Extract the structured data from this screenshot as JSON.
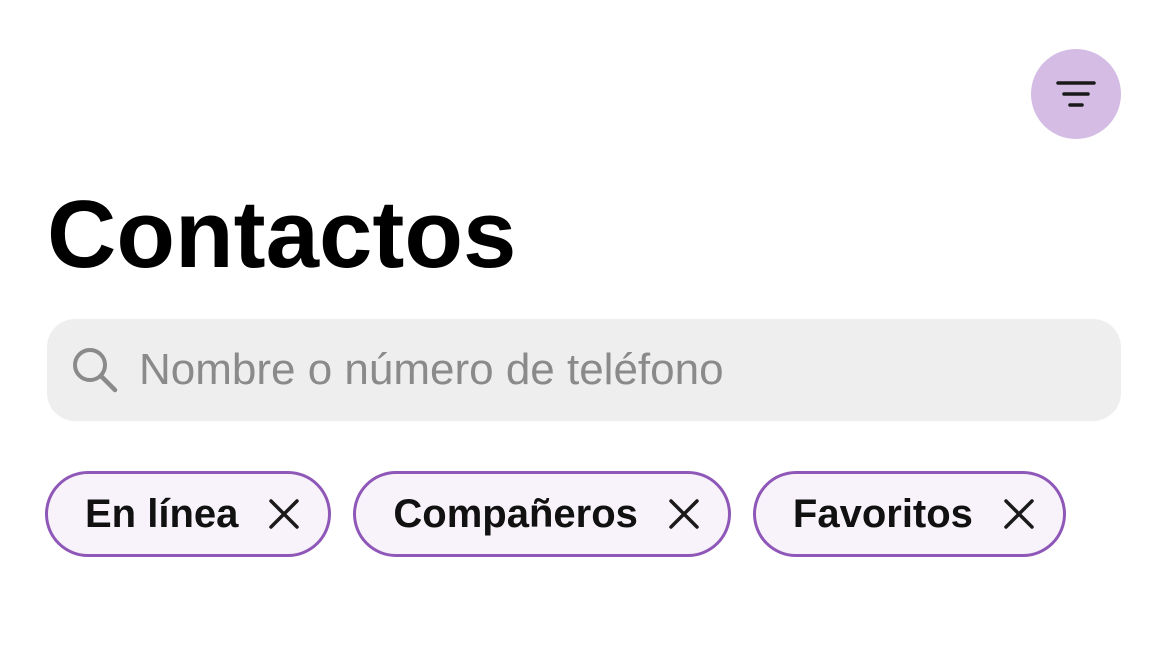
{
  "header": {
    "title": "Contactos",
    "filter_icon": "filter-lines-icon",
    "filter_button_color": "#d4bce4"
  },
  "search": {
    "placeholder": "Nombre o número de teléfono",
    "value": "",
    "icon": "search-icon"
  },
  "filters": {
    "chip_border_color": "#8e57b8",
    "chip_background": "#f8f3fa",
    "chips": [
      {
        "label": "En línea",
        "remove_icon": "close-icon"
      },
      {
        "label": "Compañeros",
        "remove_icon": "close-icon"
      },
      {
        "label": "Favoritos",
        "remove_icon": "close-icon"
      }
    ]
  }
}
